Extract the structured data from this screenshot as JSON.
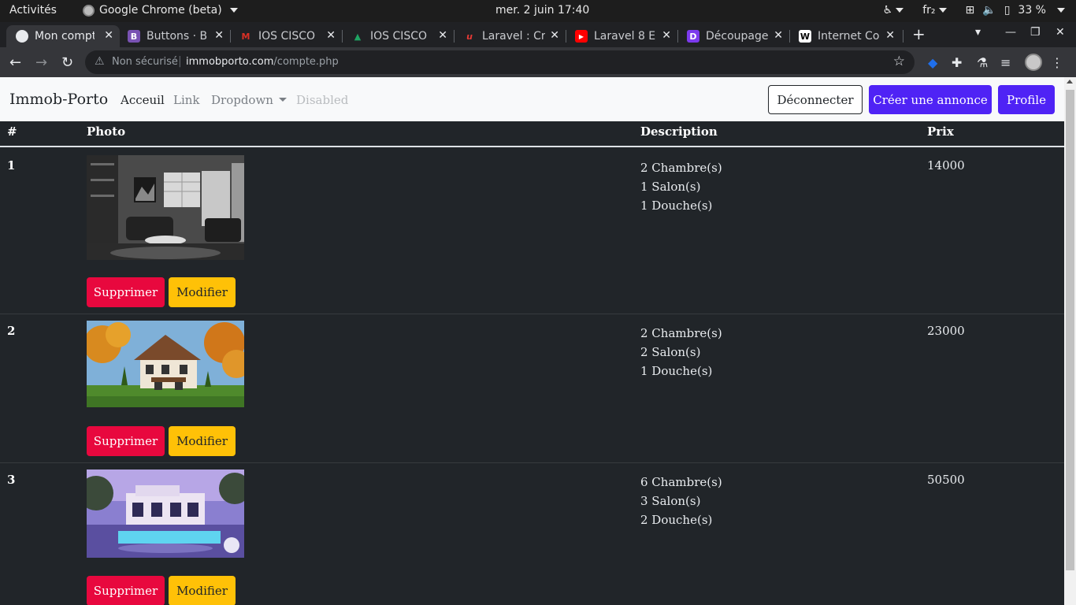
{
  "system_bar": {
    "activities": "Activités",
    "app_name": "Google Chrome (beta)",
    "clock": "mer. 2 juin  17:40",
    "keyboard_layout": "fr₂",
    "battery": "33 %"
  },
  "browser": {
    "tabs": [
      {
        "title": "Mon compte",
        "favicon_color": "#e8eaed",
        "active": true
      },
      {
        "title": "Buttons · B",
        "favicon_color": "#7952b3",
        "favicon_letter": "B",
        "active": false
      },
      {
        "title": "IOS CISCO",
        "favicon_color": "#d93025",
        "favicon_letter": "M",
        "active": false
      },
      {
        "title": "IOS CISCO",
        "favicon_color": "#1fa463",
        "favicon_letter": "▲",
        "active": false
      },
      {
        "title": "Laravel : Cr",
        "favicon_color": "#e53935",
        "favicon_letter": "u",
        "active": false
      },
      {
        "title": "Laravel 8 E",
        "favicon_color": "#ff0000",
        "favicon_letter": "▶",
        "active": false
      },
      {
        "title": "Découpage",
        "favicon_color": "#7c3aed",
        "favicon_letter": "D",
        "active": false
      },
      {
        "title": "Internet Co",
        "favicon_color": "#ffffff",
        "favicon_letter": "W",
        "active": false
      }
    ],
    "address": {
      "security_label": "Non sécurisé",
      "domain": "immobporto.com",
      "path": "/compte.php"
    }
  },
  "navbar": {
    "brand": "Immob-Porto",
    "links": [
      {
        "label": "Acceuil",
        "active": true
      },
      {
        "label": "Link",
        "active": false
      },
      {
        "label": "Dropdown",
        "active": false
      },
      {
        "label": "Disabled",
        "active": false
      }
    ],
    "logout_label": "Déconnecter",
    "create_label": "Créer une annonce",
    "profile_label": "Profile"
  },
  "table": {
    "headers": [
      "#",
      "Photo",
      "Description",
      "Prix"
    ],
    "rows": [
      {
        "num": "1",
        "desc": [
          "2 Chambre(s)",
          "1 Salon(s)",
          "1 Douche(s)"
        ],
        "price": "14000",
        "photo": "living-room-interior"
      },
      {
        "num": "2",
        "desc": [
          "2 Chambre(s)",
          "2 Salon(s)",
          "1 Douche(s)"
        ],
        "price": "23000",
        "photo": "chalet-house-autumn"
      },
      {
        "num": "3",
        "desc": [
          "6 Chambre(s)",
          "3 Salon(s)",
          "2 Douche(s)"
        ],
        "price": "50500",
        "photo": "modern-villa-pool"
      }
    ],
    "delete_label": "Supprimer",
    "edit_label": "Modifier"
  },
  "colors": {
    "primary": "#4f23f5",
    "danger": "#e8083e",
    "warning": "#ffc107",
    "page_bg": "#212529"
  }
}
